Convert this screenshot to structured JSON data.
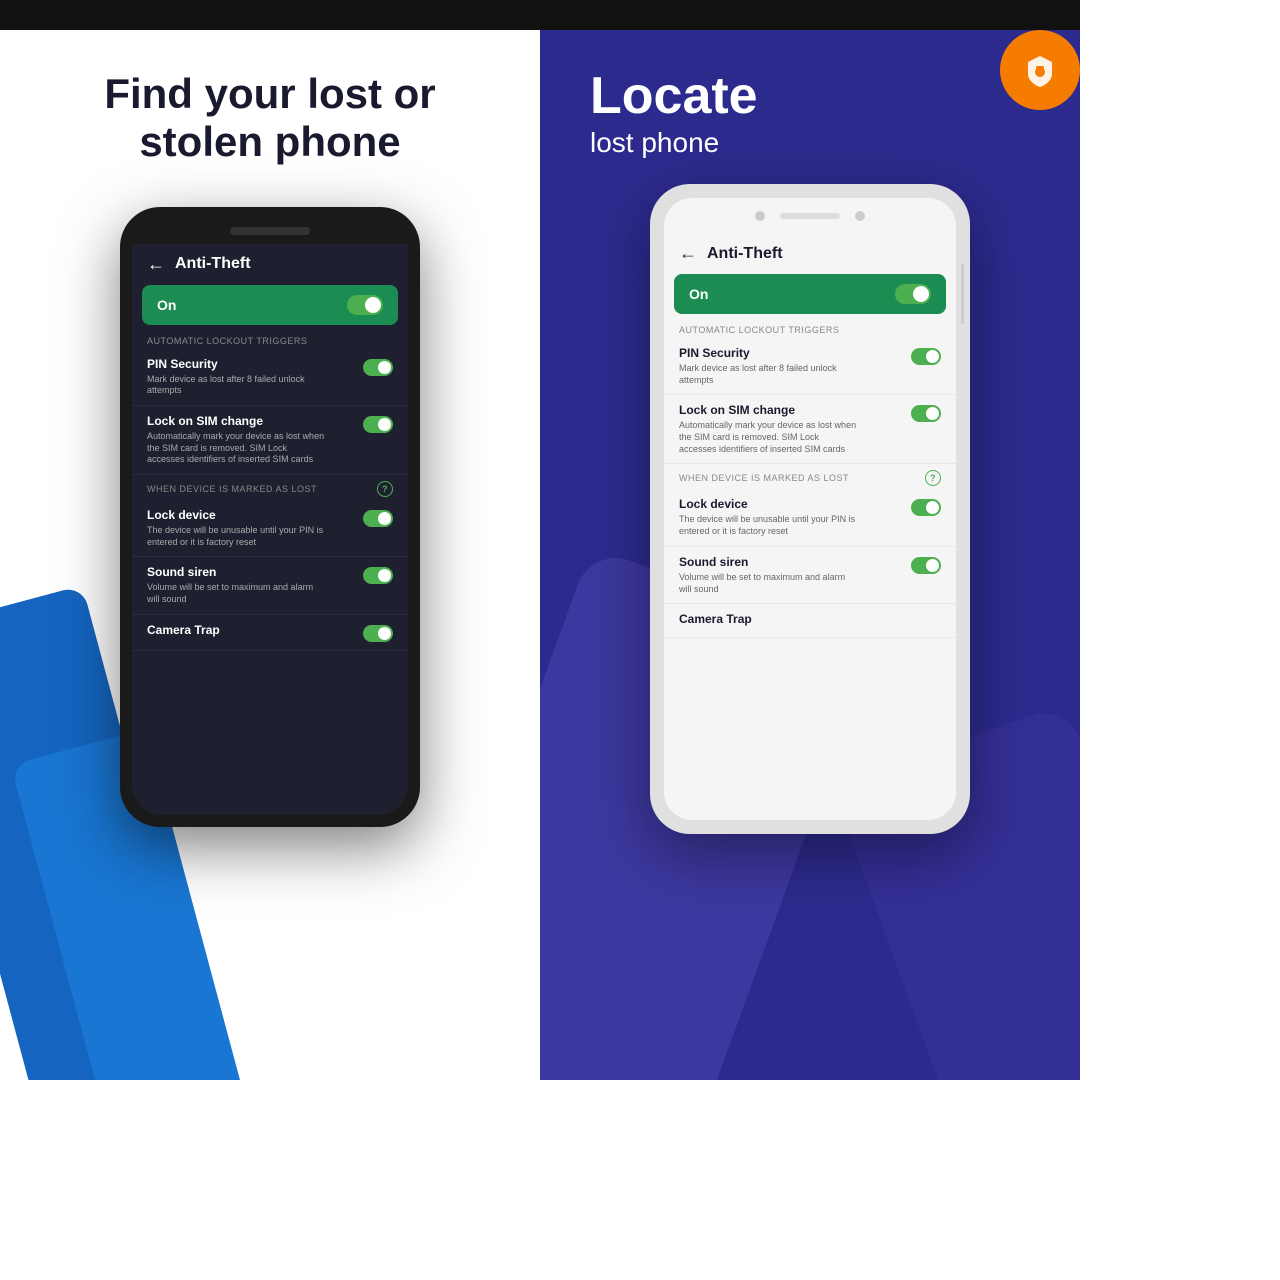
{
  "left": {
    "title": "Find your lost or stolen phone",
    "top_bar_color": "#111111",
    "phone": {
      "header_title": "Anti-Theft",
      "back_label": "←",
      "on_label": "On",
      "section1_label": "AUTOMATIC LOCKOUT TRIGGERS",
      "rows": [
        {
          "title": "PIN Security",
          "desc": "Mark device as lost after 8 failed unlock attempts",
          "enabled": true
        },
        {
          "title": "Lock on SIM change",
          "desc": "Automatically mark your device as lost when the SIM card is removed. SIM Lock accesses identifiers of inserted SIM cards",
          "enabled": true
        }
      ],
      "section2_label": "WHEN DEVICE IS MARKED AS LOST",
      "rows2": [
        {
          "title": "Lock device",
          "desc": "The device will be unusable until your PIN is entered or it is factory reset",
          "enabled": true
        },
        {
          "title": "Sound siren",
          "desc": "Volume will be set to maximum and alarm will sound",
          "enabled": true
        },
        {
          "title": "Camera Trap",
          "desc": "",
          "enabled": true
        }
      ]
    }
  },
  "right": {
    "title_locate": "Locate",
    "title_sub": "lost phone",
    "top_bar_color": "#111111",
    "phone": {
      "header_title": "Anti-Theft",
      "back_label": "←",
      "on_label": "On",
      "section1_label": "AUTOMATIC LOCKOUT TRIGGERS",
      "rows": [
        {
          "title": "PIN Security",
          "desc": "Mark device as lost after 8 failed unlock attempts",
          "enabled": true
        },
        {
          "title": "Lock on SIM change",
          "desc": "Automatically mark your device as lost when the SIM card is removed. SIM Lock accesses identifiers of inserted SIM cards",
          "enabled": true
        }
      ],
      "section2_label": "WHEN DEVICE IS MARKED AS LOST",
      "rows2": [
        {
          "title": "Lock device",
          "desc": "The device will be unusable until your PIN is entered or it is factory reset",
          "enabled": true
        },
        {
          "title": "Sound siren",
          "desc": "Volume will be set to maximum and alarm will sound",
          "enabled": true
        },
        {
          "title": "Camera Trap",
          "desc": "",
          "enabled": true
        }
      ]
    },
    "badge_icon": "🛡"
  }
}
